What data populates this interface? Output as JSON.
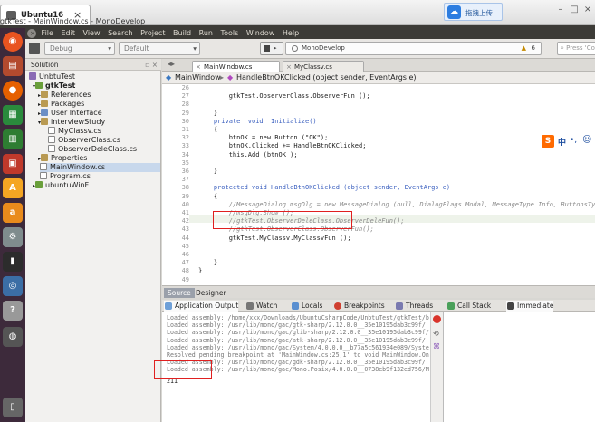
{
  "vm": {
    "tab_title": "Ubuntu16",
    "tab_close": "×",
    "upload_label": "拖拽上传",
    "window_title": "gtkTest - MainWindow.cs - MonoDevelop"
  },
  "menu": {
    "items": [
      "File",
      "Edit",
      "View",
      "Search",
      "Project",
      "Build",
      "Run",
      "Tools",
      "Window",
      "Help"
    ]
  },
  "toolbar": {
    "config": "Debug",
    "platform": "Default",
    "status": "MonoDevelop",
    "warnings": "6",
    "search_placeholder": "Press 'Control+,' to search"
  },
  "solution": {
    "header": "Solution",
    "items": [
      {
        "label": "UnbtuTest",
        "level": 0
      },
      {
        "label": "gtkTest",
        "level": 1
      },
      {
        "label": "References",
        "level": 2
      },
      {
        "label": "Packages",
        "level": 2
      },
      {
        "label": "User Interface",
        "level": 2
      },
      {
        "label": "interviewStudy",
        "level": 2
      },
      {
        "label": "MyClassv.cs",
        "level": 3
      },
      {
        "label": "ObserverClass.cs",
        "level": 3
      },
      {
        "label": "ObserverDeleClass.cs",
        "level": 3
      },
      {
        "label": "Properties",
        "level": 2
      },
      {
        "label": "MainWindow.cs",
        "level": 2
      },
      {
        "label": "Program.cs",
        "level": 2
      },
      {
        "label": "ubuntuWinF",
        "level": 1
      }
    ]
  },
  "editor": {
    "tabs": [
      "MainWindow.cs",
      "MyClassv.cs"
    ],
    "crumb_class": "MainWindow",
    "crumb_method": "HandleBtnOKClicked (object sender, EventArgs e)",
    "line_numbers": [
      "26",
      "27",
      "28",
      "29",
      "30",
      "31",
      "32",
      "33",
      "34",
      "35",
      "36",
      "37",
      "38",
      "39",
      "40",
      "41",
      "42",
      "43",
      "44",
      "45",
      "46",
      "47",
      "48",
      "49"
    ],
    "lines": [
      "",
      "        gtkTest.ObserverClass.ObserverFun ();",
      "",
      "    }",
      "    private  void  Initialize()",
      "    {",
      "        btnOK = new Button (\"OK\");",
      "        btnOK.Clicked += HandleBtnOKClicked;",
      "        this.Add (btnOK );",
      "",
      "    }",
      "",
      "    protected void HandleBtnOKClicked (object sender, EventArgs e)",
      "    {",
      "        //MessageDialog msgDlg = new MessageDialog (null, DialogFlags.Modal, MessageType.Info, ButtonsType.Ok, \"HelloWorld\");",
      "        //msgDlg.Show ();",
      "        //gtkTest.ObserverDeleClass.ObserverDeleFun();",
      "        //gtkTest.ObserverClass.ObserverFun();",
      "        gtkTest.MyClassv.MyClassvFun ();",
      "",
      "",
      "    }",
      "}",
      ""
    ]
  },
  "view_tabs": [
    "Source",
    "Designer"
  ],
  "pads": {
    "tabs": [
      "Application Output",
      "Watch",
      "Locals",
      "Breakpoints",
      "Threads",
      "Call Stack",
      "Immediate"
    ],
    "output_lines": [
      "Loaded assembly: /home/xxx/Downloads/UbuntuCsharpCode/UnbtuTest/gtkTest/b",
      "Loaded assembly: /usr/lib/mono/gac/gtk-sharp/2.12.0.0__35e10195dab3c99f/",
      "Loaded assembly: /usr/lib/mono/gac/glib-sharp/2.12.0.0__35e10195dab3c99f/",
      "Loaded assembly: /usr/lib/mono/gac/atk-sharp/2.12.0.0__35e10195dab3c99f/",
      "Loaded assembly: /usr/lib/mono/gac/System/4.0.0.0__b77a5c561934e089/Syste",
      "Resolved pending breakpoint at 'MainWindow.cs:25,1' to void MainWindow.On",
      "Loaded assembly: /usr/lib/mono/gac/gdk-sharp/2.12.0.0__35e10195dab3c99f/",
      "Loaded assembly: /usr/lib/mono/gac/Mono.Posix/4.0.0.0__0738eb9f132ed756/M",
      "211"
    ]
  },
  "colors": {
    "launcher": "#3d2a3b",
    "annotation_red": "#e02020",
    "keyword": "#3a5fbf"
  }
}
